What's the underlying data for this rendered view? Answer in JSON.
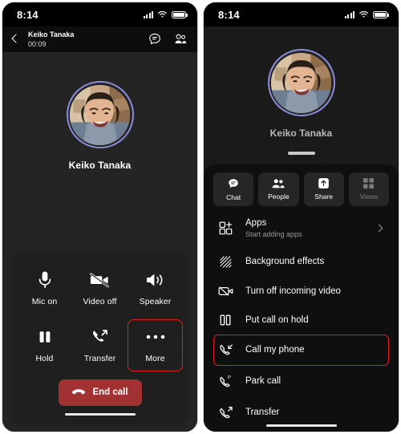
{
  "left_phone": {
    "status_bar": {
      "time": "8:14",
      "signal_icon": "cellular-bars-icon",
      "wifi_icon": "wifi-icon",
      "battery_icon": "battery-icon"
    },
    "call_header": {
      "back_icon": "back-chevron-icon",
      "contact_name": "Keiko Tanaka",
      "call_duration": "00:09",
      "chat_icon": "chat-bubble-icon",
      "people_icon": "people-icon"
    },
    "stage": {
      "avatar_name": "avatar",
      "caller_name": "Keiko Tanaka",
      "avatar_ring_color": "#8b8bdb"
    },
    "controls": [
      {
        "label": "Mic on",
        "icon": "microphone-icon",
        "highlighted": false
      },
      {
        "label": "Video off",
        "icon": "video-off-icon",
        "highlighted": false
      },
      {
        "label": "Speaker",
        "icon": "speaker-icon",
        "highlighted": false
      },
      {
        "label": "Hold",
        "icon": "pause-icon",
        "highlighted": false
      },
      {
        "label": "Transfer",
        "icon": "call-transfer-icon",
        "highlighted": false
      },
      {
        "label": "More",
        "icon": "more-dots-icon",
        "highlighted": true
      }
    ],
    "end_call": {
      "label": "End call",
      "icon": "end-call-icon",
      "color": "#a23232"
    }
  },
  "right_phone": {
    "status_bar": {
      "time": "8:14",
      "signal_icon": "cellular-bars-icon",
      "wifi_icon": "wifi-icon",
      "battery_icon": "battery-icon"
    },
    "stage": {
      "caller_name": "Keiko Tanaka",
      "avatar_ring_color": "#8b8bdb"
    },
    "sheet": {
      "handle_name": "sheet-drag-handle",
      "tabs": [
        {
          "label": "Chat",
          "icon": "chat-bubble-icon",
          "disabled": false
        },
        {
          "label": "People",
          "icon": "people-icon",
          "disabled": false
        },
        {
          "label": "Share",
          "icon": "share-up-icon",
          "disabled": false
        },
        {
          "label": "Views",
          "icon": "grid-views-icon",
          "disabled": true
        }
      ],
      "menu": [
        {
          "title": "Apps",
          "subtitle": "Start adding apps",
          "icon": "apps-grid-icon",
          "chevron": true,
          "highlighted": false
        },
        {
          "title": "Background effects",
          "subtitle": "",
          "icon": "background-effects-icon",
          "chevron": false,
          "highlighted": false
        },
        {
          "title": "Turn off incoming video",
          "subtitle": "",
          "icon": "video-off-icon",
          "chevron": false,
          "highlighted": false
        },
        {
          "title": "Put call on hold",
          "subtitle": "",
          "icon": "pause-icon",
          "chevron": false,
          "highlighted": false
        },
        {
          "title": "Call my phone",
          "subtitle": "",
          "icon": "call-my-phone-icon",
          "chevron": false,
          "highlighted": true
        },
        {
          "title": "Park call",
          "subtitle": "",
          "icon": "park-call-icon",
          "chevron": false,
          "highlighted": false
        },
        {
          "title": "Transfer",
          "subtitle": "",
          "icon": "call-transfer-icon",
          "chevron": false,
          "highlighted": false
        }
      ]
    }
  },
  "annotation_color": "#e02020"
}
